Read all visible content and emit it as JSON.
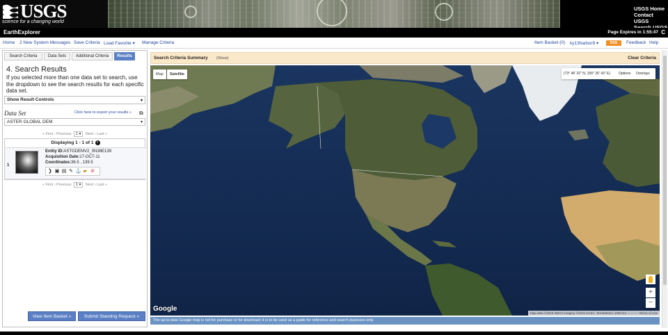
{
  "header": {
    "logo_text": "USGS",
    "tagline": "science for a changing world",
    "links": [
      "USGS Home",
      "Contact USGS",
      "Search USGS"
    ]
  },
  "titlebar": {
    "app_name": "EarthExplorer",
    "expires": "Page Expires in 1:55:47",
    "refresh_glyph": "C"
  },
  "nav": {
    "home": "Home",
    "messages": "2 New System Messages",
    "save": "Save Criteria",
    "load": "Load Favorite",
    "manage": "Manage Criteria",
    "basket": "Item Basket (0)",
    "user": "ky13harbor9",
    "rss": "RSS",
    "feedback": "Feedback",
    "help": "Help"
  },
  "tabs": [
    "Search Criteria",
    "Data Sets",
    "Additional Criteria",
    "Results"
  ],
  "results": {
    "title": "4. Search Results",
    "description": "If you selected more than one data set to search, use the dropdown to see the search results for each specific data set.",
    "controls_label": "Show Result Controls",
    "dataset_label": "Data Set",
    "export_link": "Click here to export your results »",
    "dataset_value": "ASTER GLOBAL DEM",
    "pager": {
      "first": "« First",
      "prev": "‹ Previous",
      "page": "1",
      "of": "of 1",
      "next": "Next ›",
      "last": "Last »"
    },
    "displaying": "Displaying 1 - 1 of 1",
    "row": {
      "num": "1",
      "entity_label": "Entity ID:",
      "entity_value": "ASTGDEMV2_0N36E139",
      "acq_label": "Acquisition Date:",
      "acq_value": "17-OCT-11",
      "coord_label": "Coordinates:",
      "coord_value": "36.5 , 139.5"
    },
    "view_basket": "View Item Basket »",
    "submit": "Submit Standing Request »"
  },
  "map": {
    "criteria_title": "Search Criteria Summary",
    "criteria_show": "(Show)",
    "clear": "Clear Criteria",
    "type_map": "Map",
    "type_satellite": "Satellite",
    "coords": "(73° 46' 32\" N, 156° 26' 43\" E)",
    "options": "Options",
    "overlays": "Overlays",
    "google": "Google",
    "attribution": "Map data ©2016 INEGI Imagery ©2016 NASA, TerraMetrics   1000 km ─────   Terms of Use",
    "zoom_in": "+",
    "zoom_out": "−",
    "note": "The up-to-date Google map is not for purchase or for download; it is to be used as a guide for reference and search purposes only."
  }
}
